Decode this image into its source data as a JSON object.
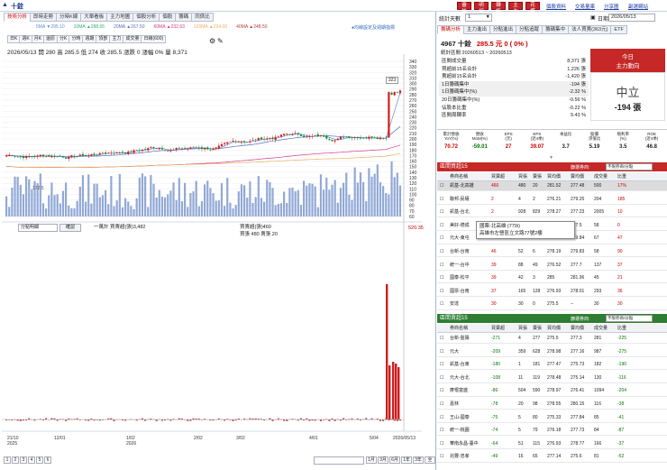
{
  "app": {
    "title": "十銓",
    "buttons": [
      "審核",
      "明細",
      "轉帳",
      "主力",
      "花蝶"
    ],
    "links": [
      "個股資料",
      "交易量庫",
      "分享圖",
      "副選網站"
    ]
  },
  "left": {
    "tabs": [
      "技術分析",
      "即時走勢",
      "分時K線",
      "大單看板",
      "主力地圖",
      "個股分析",
      "個股",
      "籌碼",
      "同儕比"
    ],
    "ma": [
      {
        "label": "5MA ▼295.10",
        "color": "#5b8fd6"
      },
      {
        "label": "10MA ▲288.65",
        "color": "#30b070"
      },
      {
        "label": "20MA ▲267.50",
        "color": "#5572c8"
      },
      {
        "label": "60MA ▲232.63",
        "color": "#d43a8a"
      },
      {
        "label": "120MA ▲224.00",
        "color": "#e8b060"
      },
      {
        "label": "40MA ▲248.50",
        "color": "#c23c3c"
      }
    ],
    "ma_note": "●均線設定及週期指標",
    "toolbar": [
      "日K",
      "週K",
      "月K",
      "還原",
      "分K",
      "分時",
      "週期",
      "頂部",
      "主力",
      "成交量",
      "日線(600)"
    ],
    "info": "2026/05/13 開 280 高 285.5 低 274 收 285.5 漲跌 0 漲幅 0% 量 8,371",
    "price_axis": [
      "340",
      "330",
      "320",
      "310",
      "300",
      "290",
      "280",
      "270",
      "260",
      "250",
      "240",
      "230",
      "220",
      "210",
      "200",
      "190",
      "180",
      "170",
      "160",
      "150",
      "140",
      "130",
      "120",
      "110",
      "100",
      "90",
      "80",
      "70",
      "60"
    ],
    "annot_high": "323",
    "annot_low": "172.5",
    "vol_label": "一萬計 買賣超(張)3,482",
    "sub_sel": "分點明細",
    "sub_btn": "確認",
    "sub_legend": [
      "買賣超(張)460",
      "買張 480 賣張 20"
    ],
    "sub_axis_top": "520.35",
    "date_axis": [
      "21/10\n2025",
      "12/01",
      "1/02\n2026",
      "2/02",
      "3/02",
      "4/01",
      "5/04",
      "2026/05/13"
    ],
    "pages": [
      "1",
      "2",
      "3",
      "4",
      "5",
      "6"
    ],
    "periods": [
      "1月",
      "3月",
      "6月",
      "1年",
      "3年",
      "全"
    ]
  },
  "right": {
    "period_label": "統計天數",
    "period_value": "1",
    "date_label": "日期",
    "date_value": "2026/05/13",
    "tabs": [
      "籌碼分析",
      "主力進出",
      "分點進出",
      "分點追蹤",
      "籌碼集中",
      "法人買賣(363元)",
      "ETF"
    ],
    "stock": "4967 十銓",
    "price": "285.5",
    "change": "元 0 ( 0% )",
    "stats_title": "統計區間 20260513 ~ 20260513",
    "stats": [
      {
        "label": "區間成交量",
        "value": "8,371 張"
      },
      {
        "label": "買超前15名合計",
        "value": "1,226 張"
      },
      {
        "label": "賣超前15名合計",
        "value": "-1,420 張"
      },
      {
        "label": "1日籌碼集中",
        "value": "-194 張"
      },
      {
        "label": "1日籌碼集中(%)",
        "value": "-2.32 %"
      },
      {
        "label": "20日籌碼集中(%)",
        "value": "-0.56 %"
      },
      {
        "label": "佔股本比重",
        "value": "-0.22 %"
      },
      {
        "label": "區間周轉率",
        "value": "9.43 %"
      }
    ],
    "today_title": "今日",
    "today_sub": "主力動向",
    "today_state": "中立",
    "today_value": "-194 張",
    "metrics": [
      {
        "h": "累計營收\nYoY(%)",
        "v": "70.72",
        "c": "#c00"
      },
      {
        "h": "營收\nMoM(%)",
        "v": "-59.01",
        "c": "#070"
      },
      {
        "h": "EPS\n(元)",
        "v": "27",
        "c": "#c00"
      },
      {
        "h": "EPS\n(近4季)",
        "v": "39.07",
        "c": "#c00"
      },
      {
        "h": "本益比",
        "v": "3.7",
        "c": "#222"
      },
      {
        "h": "股價\n淨值比",
        "v": "5.19",
        "c": "#222"
      },
      {
        "h": "殖利率\n(%)",
        "v": "3.5",
        "c": "#222"
      },
      {
        "h": "ROE\n(近4季)",
        "v": "46.8",
        "c": "#222"
      }
    ],
    "buy_title": "區間買超15",
    "sell_title": "區間賣超15",
    "filter_label": "篩選券商:",
    "filter_value": "不限券商/分點",
    "cols": [
      "券商名稱",
      "買賣超",
      "買張",
      "賣張",
      "買均價",
      "賣均價",
      "成交量",
      "比重"
    ],
    "buy_rows": [
      [
        "凱基-北高雄",
        "460",
        "480",
        "20",
        "281.52",
        "277.48",
        "500",
        "17%"
      ],
      [
        "聯邦-民權",
        "2",
        "4",
        "2",
        "276.21",
        "279.25",
        "204",
        "185"
      ],
      [
        "凱基-台北",
        "2",
        "928",
        "829",
        "278.27",
        "277.23",
        "2005",
        "10"
      ],
      [
        "美好-德成",
        "52",
        "55",
        "3",
        "285.01",
        "277.5",
        "58",
        "0"
      ],
      [
        "元大-東屯",
        "48",
        "58",
        "9",
        "277.21",
        "279.84",
        "67",
        "47"
      ],
      [
        "台新-台南",
        "46",
        "52",
        "6",
        "278.19",
        "279.83",
        "58",
        "90"
      ],
      [
        "統一-台中",
        "39",
        "88",
        "49",
        "276.52",
        "277.7",
        "137",
        "37"
      ],
      [
        "國泰-松平",
        "39",
        "42",
        "3",
        "285",
        "281.96",
        "45",
        "21"
      ],
      [
        "國票-台南",
        "37",
        "165",
        "128",
        "276.93",
        "278.01",
        "293",
        "36"
      ],
      [
        "安達",
        "30",
        "30",
        "0",
        "275.5",
        "--",
        "30",
        "30"
      ]
    ],
    "tooltip": [
      "國票-北高雄 (779i)",
      "高雄市左營區立文路77號2樓"
    ],
    "sell_rows": [
      [
        "台新-盤陽",
        "-271",
        "4",
        "277",
        "275.5",
        "277.3",
        "281",
        "-225"
      ],
      [
        "元大",
        "-209",
        "359",
        "628",
        "278.98",
        "277.16",
        "987",
        "-275"
      ],
      [
        "凱基-台東",
        "-180",
        "1",
        "181",
        "277.47",
        "275.73",
        "182",
        "-190"
      ],
      [
        "元大-台北",
        "-108",
        "11",
        "119",
        "278.48",
        "275.14",
        "130",
        "-116"
      ],
      [
        "摩根富盛",
        "-86",
        "504",
        "590",
        "278.97",
        "276.41",
        "1094",
        "-204"
      ],
      [
        "嘉林",
        "-78",
        "20",
        "98",
        "278.55",
        "280.15",
        "116",
        "-38"
      ],
      [
        "王山-國泰",
        "-75",
        "5",
        "80",
        "275.33",
        "277.84",
        "85",
        "-41"
      ],
      [
        "統一-桃園",
        "-74",
        "5",
        "79",
        "276.18",
        "277.73",
        "84",
        "-87"
      ],
      [
        "華南永昌-臺中",
        "-64",
        "51",
        "115",
        "276.93",
        "278.77",
        "166",
        "-37"
      ],
      [
        "兆豐-忠孝",
        "-49",
        "16",
        "65",
        "277.14",
        "275.6",
        "81",
        "-52"
      ]
    ]
  }
}
